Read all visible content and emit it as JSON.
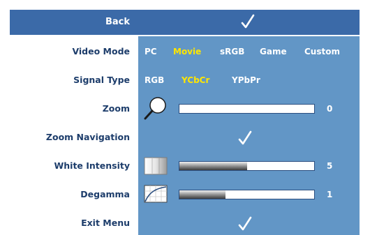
{
  "header": {
    "back_label": "Back",
    "back_check_icon": "checkmark-icon"
  },
  "rows": {
    "video_mode": {
      "label": "Video Mode",
      "options": [
        "PC",
        "Movie",
        "sRGB",
        "Game",
        "Custom"
      ],
      "selected": "Movie"
    },
    "signal_type": {
      "label": "Signal Type",
      "options": [
        "RGB",
        "YCbCr",
        "YPbPr"
      ],
      "selected": "YCbCr"
    },
    "zoom": {
      "label": "Zoom",
      "icon": "magnifier-icon",
      "value": "0",
      "level": 0
    },
    "zoom_navigation": {
      "label": "Zoom Navigation",
      "icon": "checkmark-icon"
    },
    "white_intensity": {
      "label": "White Intensity",
      "icon": "white-intensity-icon",
      "value": "5",
      "level": 0.5
    },
    "degamma": {
      "label": "Degamma",
      "icon": "degamma-curve-icon",
      "value": "1",
      "level": 0.34
    },
    "exit_menu": {
      "label": "Exit Menu",
      "icon": "checkmark-icon"
    }
  },
  "colors": {
    "header_bg": "#3b6aa8",
    "panel_bg": "#6296c6",
    "label_text": "#1d3d6b",
    "selected_option": "#ffe600"
  }
}
